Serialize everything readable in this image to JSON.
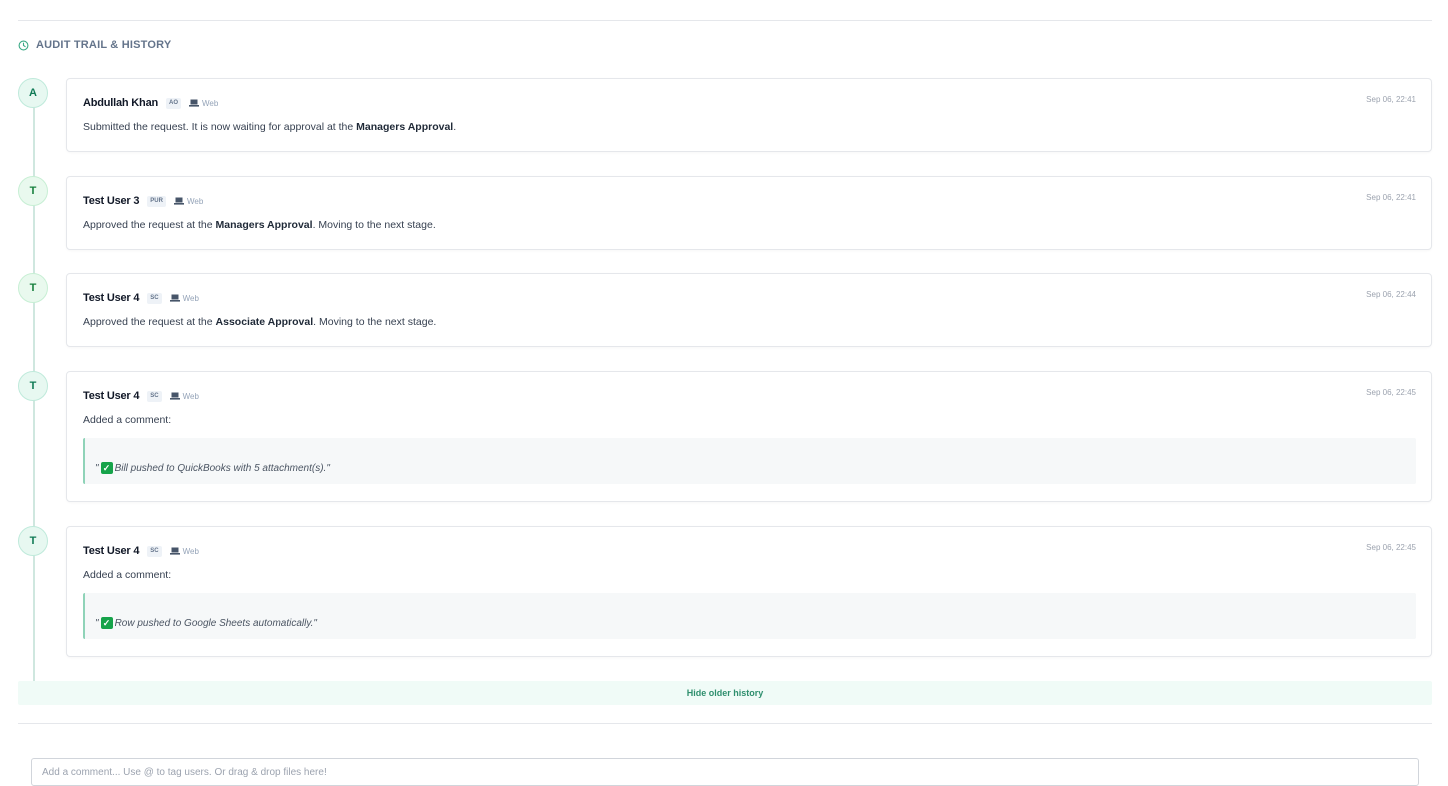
{
  "section": {
    "title": "AUDIT TRAIL & HISTORY",
    "icon": "clock-icon"
  },
  "entries": [
    {
      "initial": "A",
      "user": "Abdullah Khan",
      "role": "AO",
      "channel": "Web",
      "timestamp": "Sep 06, 22:41",
      "message_before": "Submitted the request. It is now waiting for approval at the ",
      "stage": "Managers Approval",
      "message_after": "."
    },
    {
      "initial": "T",
      "user": "Test User 3",
      "role": "PUR",
      "channel": "Web",
      "timestamp": "Sep 06, 22:41",
      "message_before": "Approved the request at the ",
      "stage": "Managers Approval",
      "message_after": ". Moving to the next stage."
    },
    {
      "initial": "T",
      "user": "Test User 4",
      "role": "SC",
      "channel": "Web",
      "timestamp": "Sep 06, 22:44",
      "message_before": "Approved the request at the ",
      "stage": "Associate Approval",
      "message_after": ". Moving to the next stage."
    },
    {
      "initial": "T",
      "user": "Test User 4",
      "role": "SC",
      "channel": "Web",
      "timestamp": "Sep 06, 22:45",
      "message": "Added a comment:",
      "quote_open": "\"",
      "quote": "Bill pushed to QuickBooks with 5 attachment(s).\""
    },
    {
      "initial": "T",
      "user": "Test User 4",
      "role": "SC",
      "channel": "Web",
      "timestamp": "Sep 06, 22:45",
      "message": "Added a comment:",
      "quote_open": "\"",
      "quote": "Row pushed to Google Sheets automatically.\""
    }
  ],
  "hide_history_label": "Hide older history",
  "comment_box": {
    "placeholder": "Add a comment... Use @ to tag users. Or drag & drop files here!"
  },
  "colors": {
    "accent": "#2f8f6e",
    "timeline": "#cfe7df",
    "check": "#16a34a"
  }
}
